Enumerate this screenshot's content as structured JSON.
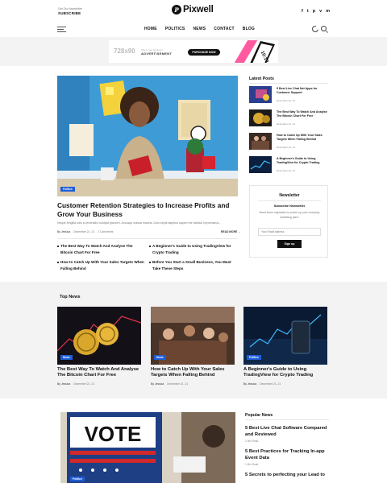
{
  "header": {
    "newsletter_small": "Get Our Newsletter",
    "newsletter_cta": "SUBSCRIBE",
    "logo_letter": "P",
    "logo": "Pixwell",
    "social": [
      "f",
      "t",
      "p",
      "v",
      "m"
    ]
  },
  "nav": [
    "HOME",
    "POLITICS",
    "NEWS",
    "CONTACT",
    "BLOG"
  ],
  "ad": {
    "size": "728x90",
    "small": "Place your business",
    "label": "ADVERTISEMENT",
    "button": "PURCHASE NOW",
    "phone_text": "10:10"
  },
  "hero": {
    "category": "Politics",
    "title": "Customer Retention Strategies to Increase Profits and Grow Your Business",
    "excerpt": "Neque fringilla odio a venenatis volutpat gravcert. Accusqu massa maxina. Duis turpis dapibus sapien the facilisis Nymenaeos...",
    "author": "By Jessica",
    "date": "December 21, 21",
    "comments": "2 Comments",
    "read_more": "READ MORE →"
  },
  "related": [
    "The Best Way To Watch And Analyse The Bitcoin Chart For Free",
    "A Beginner's Guide to Using TradingView for Crypto Trading",
    "How to Catch Up With Your Sales Targets When Falling Behind",
    "Before You Start a Small Business, You Must Take These Steps"
  ],
  "latest": {
    "heading": "Latest Posts",
    "items": [
      {
        "title": "5 Best Live Chat Net Apps for Customer Support",
        "date": "December 21, 21"
      },
      {
        "title": "The Best Way To Watch And Analyse The Bitcoin Chart For Free",
        "date": "December 21, 21"
      },
      {
        "title": "How to Catch Up With Your Sales Targets When Falling Behind",
        "date": "December 21, 21"
      },
      {
        "title": "A Beginner's Guide to Using TradingView for Crypto Trading",
        "date": "December 21, 21"
      }
    ]
  },
  "newsletter": {
    "title": "Newsletter",
    "subtitle": "Subscribe Newsletter",
    "desc": "Need some inspiration to power up your company marketing plan?",
    "placeholder": "Your Email address",
    "button": "Sign up"
  },
  "top_news": {
    "heading": "Top News",
    "cards": [
      {
        "category": "News",
        "title": "The Best Way To Watch And Analyse The Bitcoin Chart For Free",
        "author": "By Jessica",
        "date": "December 21, 21"
      },
      {
        "category": "News",
        "title": "How to Catch Up With Your Sales Targets When Falling Behind",
        "author": "By Jessica",
        "date": "December 21, 21"
      },
      {
        "category": "Politics",
        "title": "A Beginner's Guide to Using TradingView for Crypto Trading",
        "author": "By Jessica",
        "date": "December 21, 21"
      }
    ]
  },
  "vote_image": {
    "sign": "VOTE",
    "category": "Politics"
  },
  "popular": {
    "heading": "Popular News",
    "items": [
      {
        "title": "5 Best Live Chat Software Compared and Reviewed",
        "read": "1 Min Read"
      },
      {
        "title": "5 Best Practices for Tracking In-app Event Data",
        "read": "1 Min Read"
      },
      {
        "title": "5 Secrets to perfecting your Lead to",
        "read": ""
      }
    ]
  },
  "colors": {
    "accent": "#1f5dd6",
    "band": "#f3f3f3",
    "text": "#111111"
  }
}
